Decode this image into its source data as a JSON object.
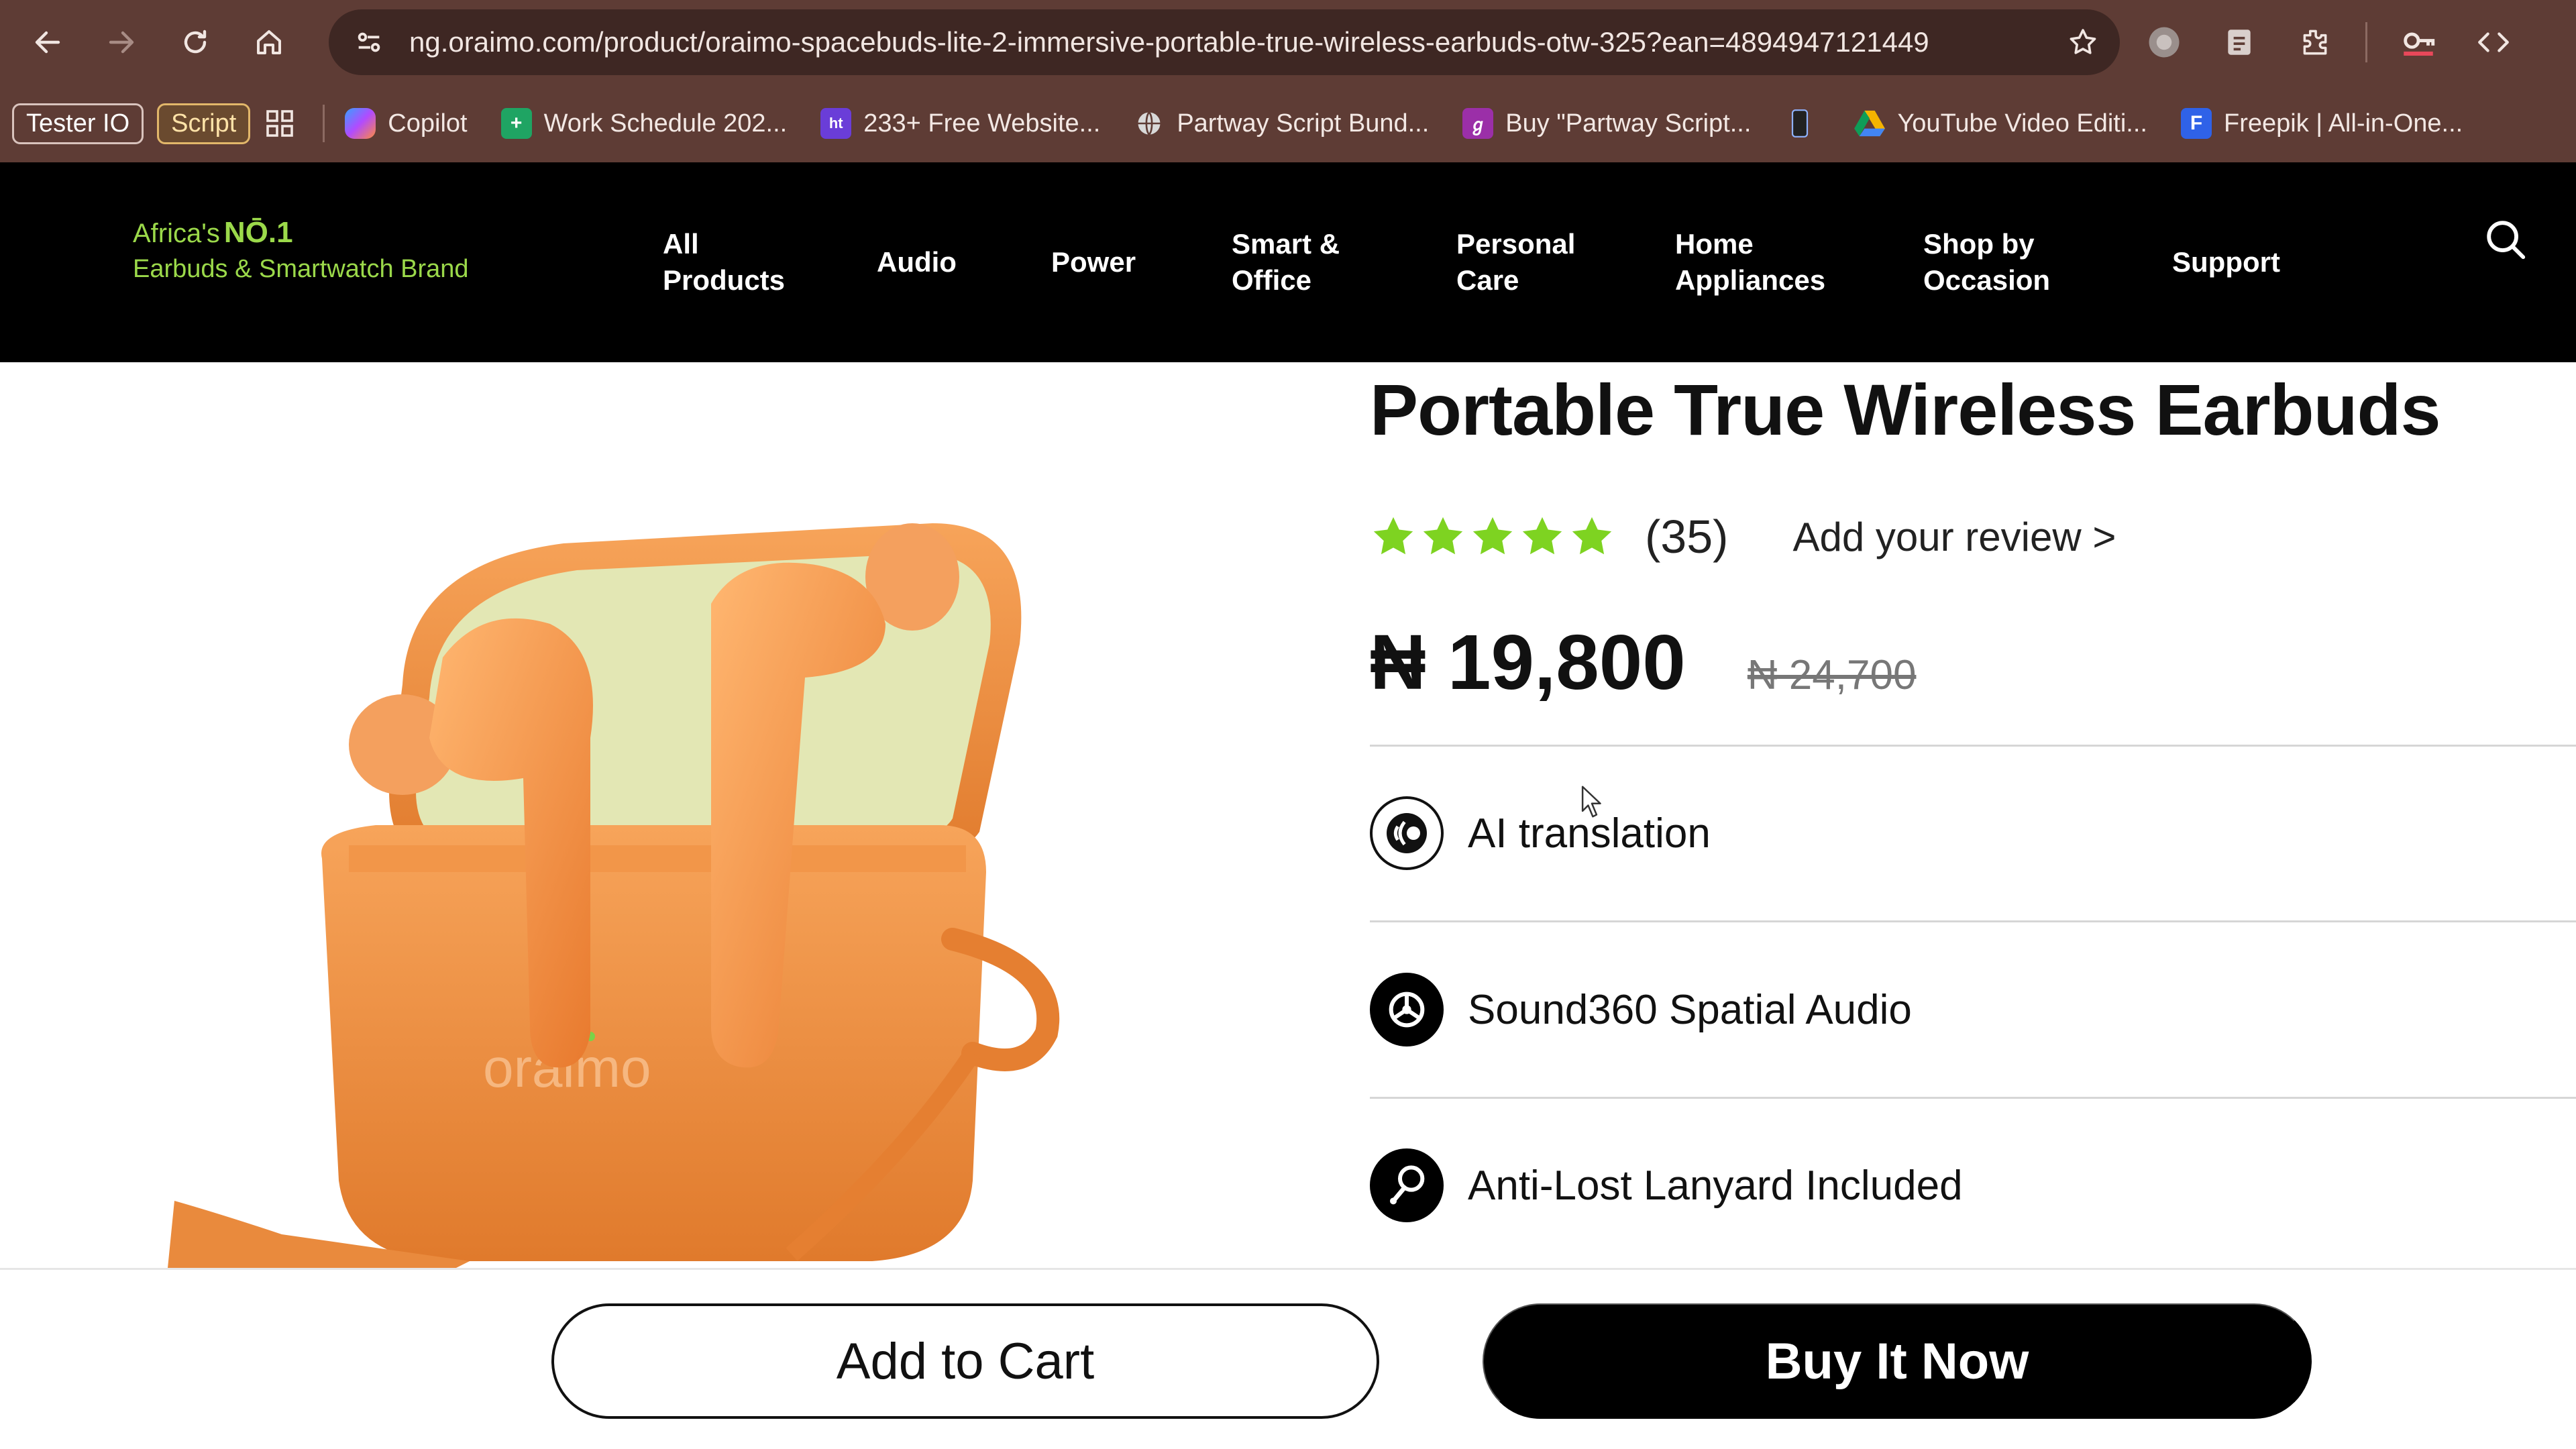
{
  "browser": {
    "url": "ng.oraimo.com/product/oraimo-spacebuds-lite-2-immersive-portable-true-wireless-earbuds-otw-325?ean=4894947121449",
    "bookmarks": [
      {
        "label": "Tester IO",
        "kind": "pill"
      },
      {
        "label": "Script",
        "kind": "pill"
      },
      {
        "label": "Copilot",
        "icon": "copilot-icon",
        "color": "#7b61ff"
      },
      {
        "label": "Work Schedule 202...",
        "icon": "sheets-plus-icon",
        "color": "#1fa463"
      },
      {
        "label": "233+ Free Website...",
        "icon": "site-icon",
        "color": "#6a3dd8"
      },
      {
        "label": "Partway Script Bund...",
        "icon": "globe-icon",
        "color": "#cfcfcf"
      },
      {
        "label": "Buy \"Partway Script...",
        "icon": "partway-icon",
        "color": "#9b2fa8"
      },
      {
        "label": "",
        "icon": "phone-icon",
        "color": "#3a3a3a"
      },
      {
        "label": "YouTube Video Editi...",
        "icon": "drive-icon",
        "color": "#f4b400"
      },
      {
        "label": "Freepik | All-in-One...",
        "icon": "freepik-icon",
        "color": "#2f62e8"
      }
    ]
  },
  "header": {
    "logo_line1_prefix": "Africa's",
    "logo_line1_badge": "NŌ.1",
    "logo_line2": "Earbuds & Smartwatch Brand",
    "logo_color": "#9bd94a",
    "nav": [
      {
        "line1": "All",
        "line2": "Products"
      },
      {
        "line1": "Audio",
        "line2": ""
      },
      {
        "line1": "Power",
        "line2": ""
      },
      {
        "line1": "Smart &",
        "line2": "Office"
      },
      {
        "line1": "Personal",
        "line2": "Care"
      },
      {
        "line1": "Home",
        "line2": "Appliances"
      },
      {
        "line1": "Shop by",
        "line2": "Occasion"
      },
      {
        "line1": "Support",
        "line2": ""
      }
    ]
  },
  "product": {
    "title": "Portable True Wireless Earbuds",
    "rating": 5,
    "rating_color": "#7ed321",
    "review_count": "(35)",
    "add_review": "Add your review >",
    "price": "₦ 19,800",
    "old_price": "₦ 24,700",
    "case_brand": "oraimo",
    "product_color": "#ef8a3c",
    "features": [
      {
        "icon": "ai-translation-icon",
        "label": "AI translation"
      },
      {
        "icon": "spatial-audio-icon",
        "label": "Sound360 Spatial Audio"
      },
      {
        "icon": "lanyard-icon",
        "label": "Anti-Lost Lanyard Included"
      }
    ]
  },
  "actions": {
    "add_to_cart": "Add to Cart",
    "buy_now": "Buy It Now"
  }
}
